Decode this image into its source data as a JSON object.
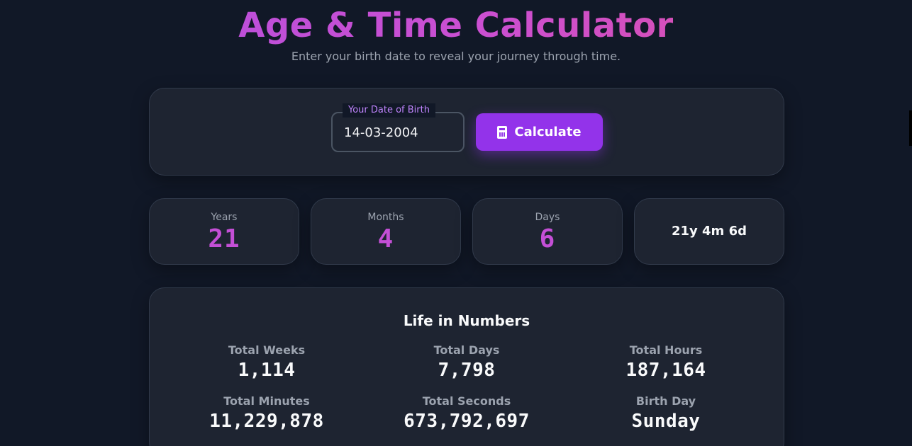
{
  "header": {
    "title": "Age & Time Calculator",
    "subtitle": "Enter your birth date to reveal your journey through time."
  },
  "input": {
    "label": "Your Date of Birth",
    "value": "14-03-2004",
    "button_label": "Calculate",
    "button_icon": "calculator-icon"
  },
  "age": {
    "years_label": "Years",
    "years": "21",
    "months_label": "Months",
    "months": "4",
    "days_label": "Days",
    "days": "6",
    "summary": "21y 4m 6d"
  },
  "life": {
    "title": "Life in Numbers",
    "weeks_label": "Total Weeks",
    "weeks": "1,114",
    "days_label": "Total Days",
    "days": "7,798",
    "hours_label": "Total Hours",
    "hours": "187,164",
    "minutes_label": "Total Minutes",
    "minutes": "11,229,878",
    "seconds_label": "Total Seconds",
    "seconds": "673,792,697",
    "birthday_label": "Birth Day",
    "birthday": "Sunday"
  },
  "colors": {
    "background": "#111827",
    "card": "#1e2431",
    "accent": "#9333ea",
    "accent_text": "#c44fd6",
    "label": "#c084fc"
  }
}
